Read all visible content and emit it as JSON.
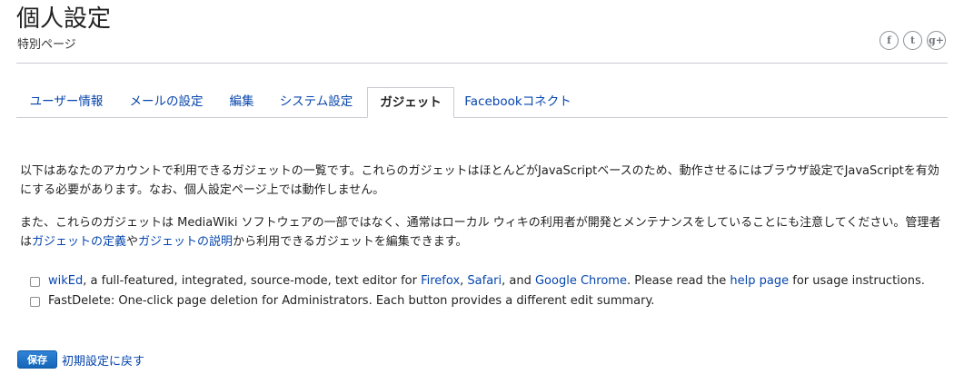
{
  "header": {
    "title": "個人設定",
    "subtitle": "特別ページ",
    "social": [
      {
        "icon": "facebook-icon",
        "glyph": "f"
      },
      {
        "icon": "twitter-icon",
        "glyph": "t"
      },
      {
        "icon": "google-plus-icon",
        "glyph": "g+"
      }
    ]
  },
  "tabs": [
    {
      "label": "ユーザー情報",
      "active": false
    },
    {
      "label": "メールの設定",
      "active": false
    },
    {
      "label": "編集",
      "active": false
    },
    {
      "label": "システム設定",
      "active": false
    },
    {
      "label": "ガジェット",
      "active": true
    },
    {
      "label": "Facebookコネクト",
      "active": false
    }
  ],
  "intro": {
    "p1": "以下はあなたのアカウントで利用できるガジェットの一覧です。これらのガジェットはほとんどがJavaScriptベースのため、動作させるにはブラウザ設定でJavaScriptを有効にする必要があります。なお、個人設定ページ上では動作しません。",
    "p2_before": "また、これらのガジェットは MediaWiki ソフトウェアの一部ではなく、通常はローカル ウィキの利用者が開発とメンテナンスをしていることにも注意してください。管理者は",
    "p2_link1": "ガジェットの定義",
    "p2_mid": "や",
    "p2_link2": "ガジェットの説明",
    "p2_after": "から利用できるガジェットを編集できます。"
  },
  "gadgets": [
    {
      "name": "wikEd",
      "text1": ", a full-featured, integrated, source-mode, text editor for ",
      "link_firefox": "Firefox",
      "sep1": ", ",
      "link_safari": "Safari",
      "sep2": ", and ",
      "link_chrome": "Google Chrome",
      "text2": ". Please read the ",
      "link_help": "help page",
      "text3": " for usage instructions.",
      "checked": false
    },
    {
      "text": "FastDelete: One-click page deletion for Administrators. Each button provides a different edit summary.",
      "checked": false
    }
  ],
  "actions": {
    "save_label": "保存",
    "reset_label": "初期設定に戻す"
  },
  "colors": {
    "link": "#0645ad",
    "button": "#1a6fc3",
    "border": "#c8ccd1"
  }
}
